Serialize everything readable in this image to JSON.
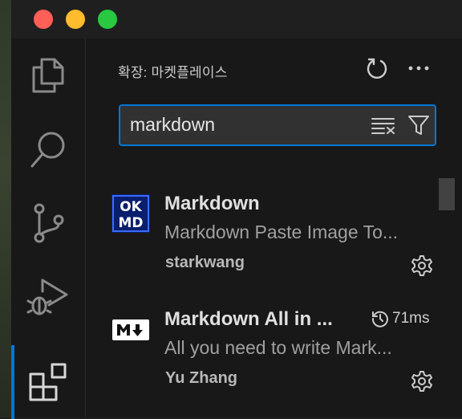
{
  "window": {
    "traffic_lights": {
      "close": "#fe5f57",
      "minimize": "#febc2e",
      "zoom": "#28c840"
    }
  },
  "activity_bar": {
    "items": [
      {
        "icon": "files-icon",
        "active": false
      },
      {
        "icon": "search-icon",
        "active": false
      },
      {
        "icon": "source-control-icon",
        "active": false
      },
      {
        "icon": "run-debug-icon",
        "active": false
      },
      {
        "icon": "extensions-icon",
        "active": true
      }
    ],
    "accent": "#0078d4"
  },
  "sidebar": {
    "title": "확장: 마켓플레이스",
    "actions": [
      {
        "icon": "refresh-icon"
      },
      {
        "icon": "more-icon"
      }
    ],
    "search": {
      "value": "markdown",
      "buttons": [
        {
          "icon": "clear-results-icon"
        },
        {
          "icon": "filter-icon"
        }
      ]
    }
  },
  "extensions": [
    {
      "icon": "okmd-logo-icon",
      "name": "Markdown",
      "description": "Markdown Paste Image To...",
      "publisher": "starkwang",
      "timing": ""
    },
    {
      "icon": "markdown-logo-icon",
      "name": "Markdown All in ...",
      "description": "All you need to write Mark...",
      "publisher": "Yu Zhang",
      "timing": "71ms"
    }
  ]
}
